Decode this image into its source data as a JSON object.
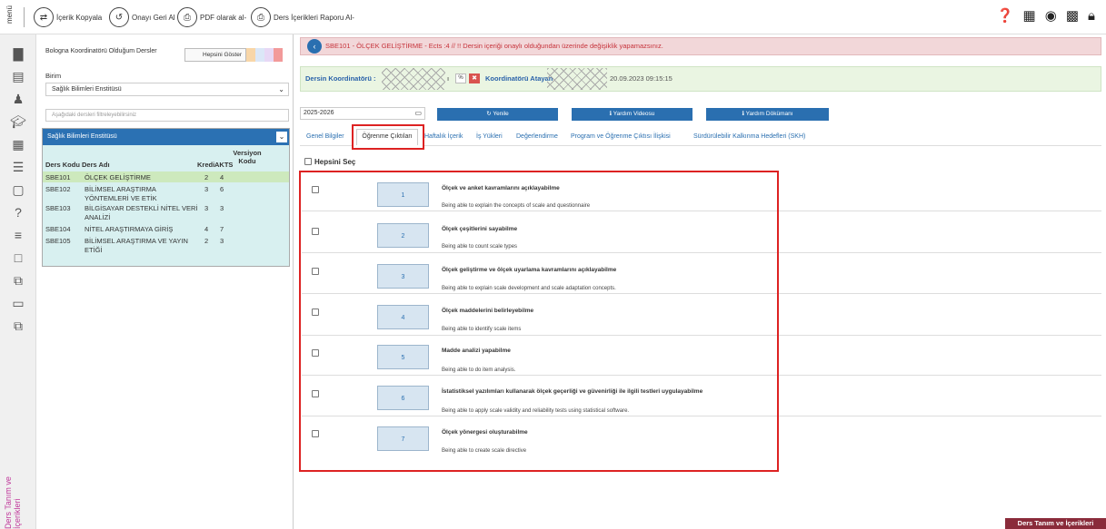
{
  "topbar": {
    "menu_label": "menü",
    "buttons": [
      {
        "label": "İçerik Kopyala",
        "icon": "swap-icon"
      },
      {
        "label": "Onayı Geri Al",
        "icon": "undo-icon"
      },
      {
        "label": "PDF olarak al-",
        "icon": "print-icon"
      },
      {
        "label": "Ders İçerikleri Raporu Al-",
        "icon": "print-icon"
      }
    ],
    "right_icons": [
      "help-icon",
      "calendar-icon",
      "globe-icon",
      "grid-icon",
      "lock-icon"
    ]
  },
  "rail": {
    "vertical_label": "Ders Tanım ve İçerikleri"
  },
  "left": {
    "bologna_label": "Bologna Koordinatörü Olduğum Dersler",
    "show_all": "Hepsini Göster",
    "swatches": [
      "#f8d6a8",
      "#dbe7f7",
      "#e7d8f5",
      "#f29a9a"
    ],
    "birim_label": "Birim",
    "birim_value": "Sağlık Bilimleri Enstitüsü",
    "filter_placeholder": "Aşağıdaki dersleri filtreleyebilirsiniz",
    "institute_header": "Sağlık Bilimleri Enstitüsü",
    "columns": {
      "code": "Ders Kodu",
      "name": "Ders Adı",
      "credit": "Kredi",
      "akts": "AKTS",
      "version": "Versiyon Kodu"
    },
    "courses": [
      {
        "code": "SBE101",
        "name": "ÖLÇEK GELİŞTİRME",
        "credit": "2",
        "akts": "4"
      },
      {
        "code": "SBE102",
        "name": "BİLİMSEL ARAŞTIRMA YÖNTEMLERİ VE ETİK",
        "credit": "3",
        "akts": "6"
      },
      {
        "code": "SBE103",
        "name": "BİLGİSAYAR DESTEKLİ NİTEL VERİ ANALİZİ",
        "credit": "3",
        "akts": "3"
      },
      {
        "code": "SBE104",
        "name": "NİTEL ARAŞTIRMAYA GİRİŞ",
        "credit": "4",
        "akts": "7"
      },
      {
        "code": "SBE105",
        "name": "BİLİMSEL ARAŞTIRMA VE YAYIN ETİĞİ",
        "credit": "2",
        "akts": "3"
      }
    ]
  },
  "main": {
    "alert": "SBE101 - ÖLÇEK GELİŞTİRME - Ects :4 // !! Dersin içeriği onaylı olduğundan üzerinde değişiklik yapamazsınız.",
    "coordinator_label": "Dersin Koordinatörü :",
    "coordinator_suffix": "ı",
    "pct": "%",
    "assigner_label": "Koordinatörü Atayan",
    "assign_date": "20.09.2023 09:15:15",
    "year": "2025-2026",
    "buttons": {
      "refresh": "Yenile",
      "video": "Yardım Videosu",
      "doc": "Yardım Dökümanı"
    },
    "tabs": [
      "Genel Bilgiler",
      "Öğrenme Çıktıları",
      "Haftalık İçerik",
      "İş Yükleri",
      "Değerlendirme",
      "Program ve Öğrenme Çıktısı İlişkisi",
      "Sürdürülebilir Kalkınma Hedefleri (SKH)"
    ],
    "select_all": "Hepsini Seç",
    "outcomes": [
      {
        "num": "1",
        "tr": "Ölçek ve anket kavramlarını açıklayabilme",
        "en": "Being able to explain the concepts of scale and questionnaire"
      },
      {
        "num": "2",
        "tr": "Ölçek çeşitlerini sayabilme",
        "en": "Being able to count scale types"
      },
      {
        "num": "3",
        "tr": "Ölçek geliştirme ve ölçek uyarlama kavramlarını açıklayabilme",
        "en": "Being able to explain scale development and scale adaptation concepts."
      },
      {
        "num": "4",
        "tr": "Ölçek maddelerini belirleyebilme",
        "en": "Being able to identify scale items"
      },
      {
        "num": "5",
        "tr": "Madde analizi yapabilme",
        "en": "Being able to do item analysis."
      },
      {
        "num": "6",
        "tr": "İstatistiksel yazılımları kullanarak ölçek geçerliği ve güvenirliği ile ilgili testleri uygulayabilme",
        "en": "Being able to apply scale validity and reliability tests using statistical software."
      },
      {
        "num": "7",
        "tr": "Ölçek yönergesi oluşturabilme",
        "en": "Being able to create scale directive"
      }
    ]
  },
  "bottom_tab": "Ders Tanım ve İçerikleri"
}
